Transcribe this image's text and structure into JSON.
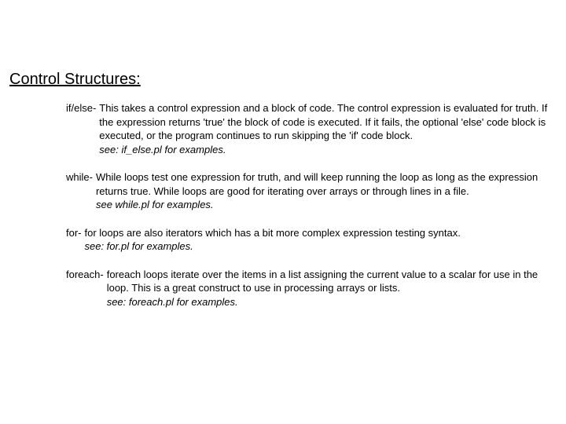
{
  "heading": "Control Structures:",
  "entries": [
    {
      "term": "if/else-",
      "desc": "This takes a control expression and a block of code.  The control expression is evaluated for truth.  If the expression returns 'true' the block of code is executed.  If it fails, the optional 'else' code block is executed, or the program continues to run skipping the 'if' code block.",
      "see": "see:  if_else.pl for examples."
    },
    {
      "term": "while-",
      "desc": "While loops test one expression for truth, and will keep running the loop as long as the expression returns true.  While loops are good for iterating over arrays or through lines in a file.",
      "see": "see while.pl for examples."
    },
    {
      "term": "for-",
      "desc": "for loops are also iterators which has a bit more complex expression testing syntax.",
      "see": "see: for.pl for examples."
    },
    {
      "term": "foreach-",
      "desc": "foreach loops iterate over the items in a list assigning the current value to a scalar for use in the loop.  This is a great construct to use in processing arrays or lists.",
      "see": "see:  foreach.pl for examples."
    }
  ]
}
